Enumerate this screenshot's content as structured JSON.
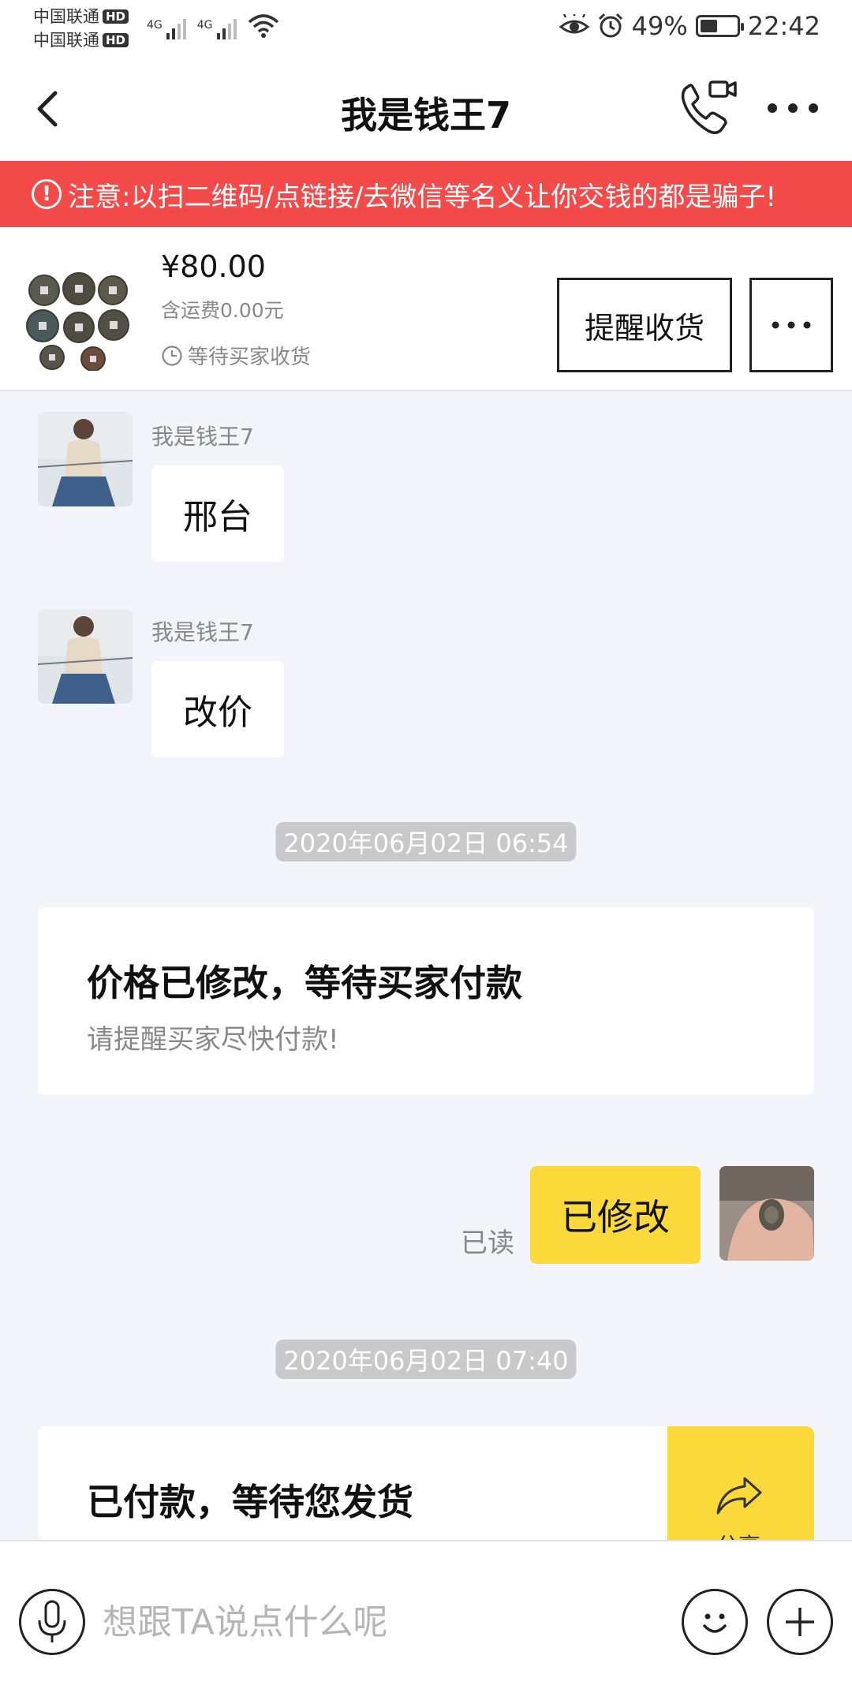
{
  "status_bar": {
    "carrier1": "中国联通",
    "carrier2": "中国联通",
    "hd_badge": "HD",
    "network1": "4G",
    "network2": "4G",
    "battery_text": "49%",
    "battery_level": 0.49,
    "time": "22:42"
  },
  "header": {
    "title": "我是钱王7"
  },
  "warning": {
    "icon": "!",
    "text": "注意:以扫二维码/点链接/去微信等名义让你交钱的都是骗子!"
  },
  "order": {
    "price": "¥80.00",
    "shipping": "含运费0.00元",
    "status": "等待买家收货",
    "remind_button": "提醒收货"
  },
  "messages": [
    {
      "sender": "我是钱王7",
      "text": "邢台"
    },
    {
      "sender": "我是钱王7",
      "text": "改价"
    }
  ],
  "timestamps": [
    "2020年06月02日 06:54",
    "2020年06月02日 07:40"
  ],
  "system_cards": [
    {
      "title": "价格已修改，等待买家付款",
      "subtitle": "请提醒买家尽快付款!"
    },
    {
      "title": "已付款，等待您发货"
    }
  ],
  "my_message": {
    "text": "已修改",
    "read": "已读"
  },
  "share_label": "分享",
  "input": {
    "placeholder": "想跟TA说点什么呢"
  },
  "colors": {
    "warning": "#f34a4a",
    "accent_yellow": "#fbd93b",
    "background": "#f4f5fa"
  }
}
